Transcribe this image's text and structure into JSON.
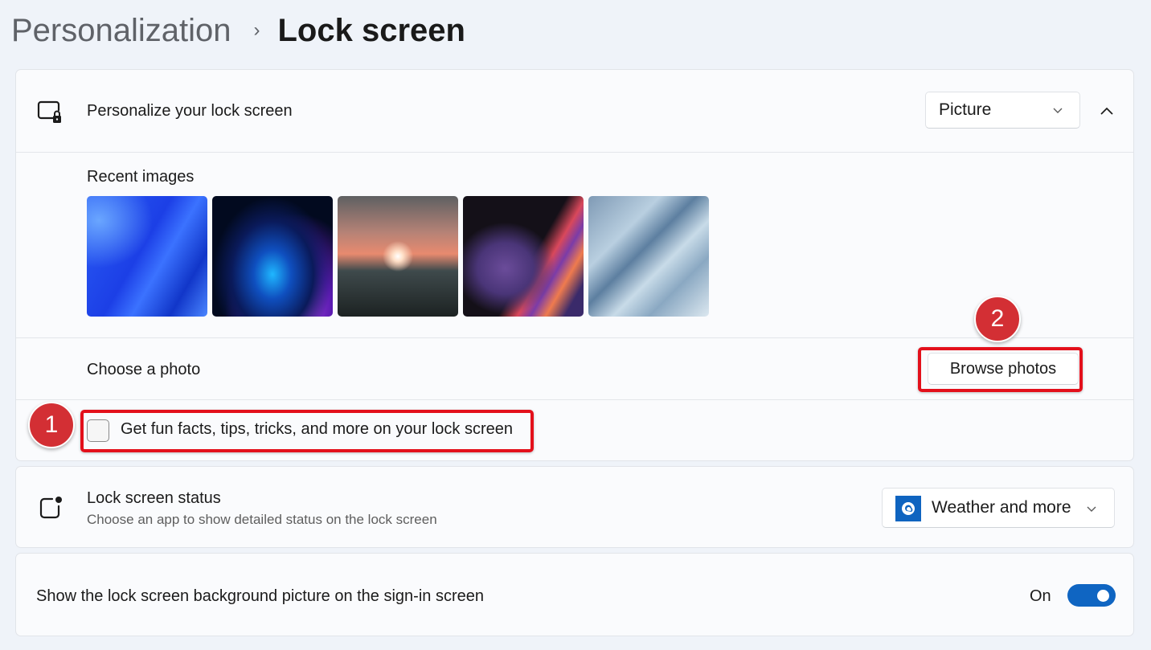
{
  "breadcrumb": {
    "parent": "Personalization",
    "separator": "›",
    "current": "Lock screen"
  },
  "personalize": {
    "label": "Personalize your lock screen",
    "icon": "lock-screen-icon",
    "dropdown_value": "Picture",
    "expanded": true,
    "recent_images_label": "Recent images",
    "recent_images": [
      {
        "name": "blue-bloom-wallpaper"
      },
      {
        "name": "glowing-orb-wallpaper"
      },
      {
        "name": "sunset-lake-wallpaper"
      },
      {
        "name": "colorful-ribbon-wallpaper"
      },
      {
        "name": "light-blue-bloom-wallpaper"
      }
    ],
    "choose_photo_label": "Choose a photo",
    "browse_button": "Browse photos",
    "fun_facts_label": "Get fun facts, tips, tricks, and more on your lock screen",
    "fun_facts_checked": false
  },
  "status": {
    "title": "Lock screen status",
    "subtitle": "Choose an app to show detailed status on the lock screen",
    "dropdown_value": "Weather and more",
    "app_icon": "weather-app-icon"
  },
  "signin": {
    "label": "Show the lock screen background picture on the sign-in screen",
    "toggle_label": "On",
    "toggle_on": true
  },
  "annotations": {
    "badge_1": "1",
    "badge_2": "2",
    "highlight_color": "#e3101b"
  },
  "colors": {
    "accent": "#0f65c2",
    "background": "#eff3f9",
    "card": "#fafbfd"
  }
}
